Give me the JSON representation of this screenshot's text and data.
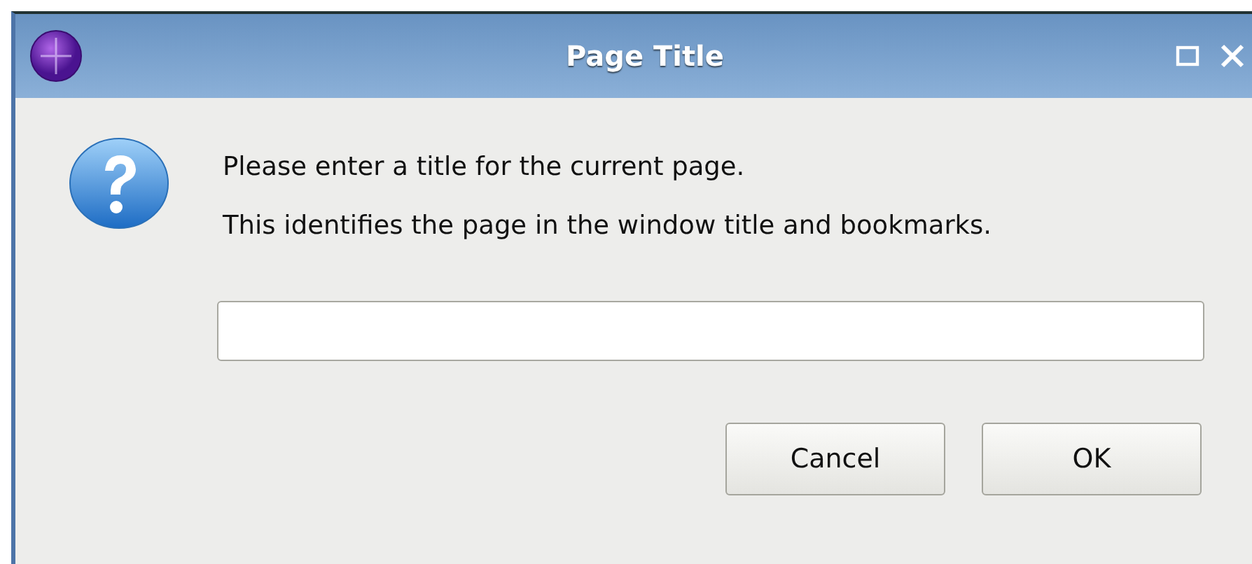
{
  "window": {
    "title": "Page Title"
  },
  "message": {
    "lines": [
      "Please enter a title for the current page.",
      "This identifies the page in the window title and bookmarks."
    ]
  },
  "buttons": [
    {
      "label": "Cancel"
    },
    {
      "label": "OK"
    }
  ]
}
